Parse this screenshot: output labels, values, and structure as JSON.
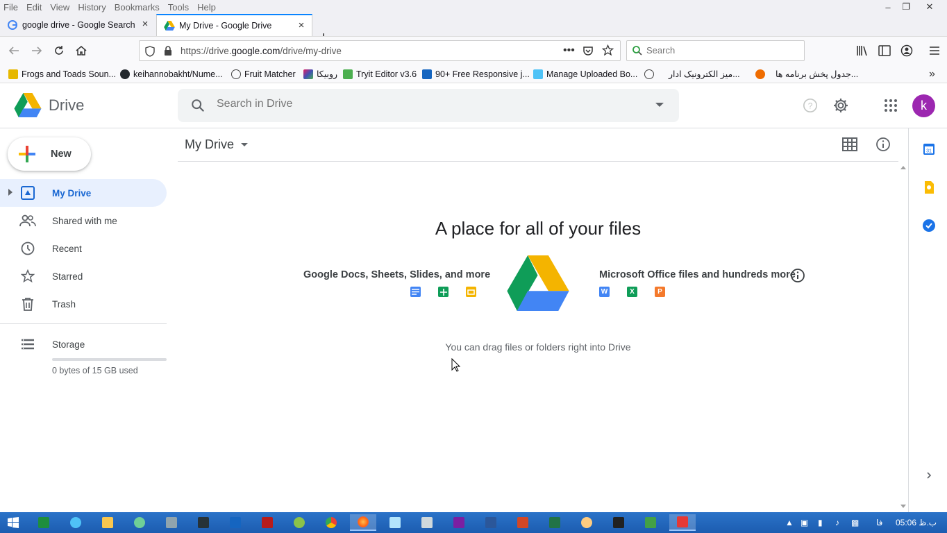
{
  "browser": {
    "menu": [
      "File",
      "Edit",
      "View",
      "History",
      "Bookmarks",
      "Tools",
      "Help"
    ],
    "tabs": [
      {
        "title": "google drive - Google Search",
        "active": false
      },
      {
        "title": "My Drive - Google Drive",
        "active": true
      }
    ],
    "url_prefix": "https://drive.",
    "url_domain": "google.com",
    "url_path": "/drive/my-drive",
    "search_placeholder": "Search",
    "bookmarks": [
      "Frogs and Toads Soun...",
      "keihannobakht/Nume...",
      "Fruit Matcher",
      "روبیکا",
      "Tryit Editor v3.6",
      "90+ Free Responsive j...",
      "Manage Uploaded Bo...",
      "میز الکترونیک ادار...",
      "جدول پخش برنامه ها..."
    ]
  },
  "drive": {
    "logo_text": "Drive",
    "search_placeholder": "Search in Drive",
    "avatar_letter": "k",
    "new_button": "New",
    "sidebar": {
      "items": [
        {
          "label": "My Drive",
          "active": true
        },
        {
          "label": "Shared with me",
          "active": false
        },
        {
          "label": "Recent",
          "active": false
        },
        {
          "label": "Starred",
          "active": false
        },
        {
          "label": "Trash",
          "active": false
        }
      ],
      "storage_label": "Storage",
      "storage_used": "0 bytes of 15 GB used",
      "storage_fraction": 0
    },
    "main": {
      "title": "My Drive",
      "empty_title": "A place for all of your files",
      "left_label": "Google Docs, Sheets, Slides, and more",
      "right_label": "Microsoft Office files and hundreds more",
      "left_icons": [
        "docs-icon",
        "sheets-icon",
        "slides-icon"
      ],
      "right_icons": [
        {
          "name": "word-icon",
          "letter": "W"
        },
        {
          "name": "excel-icon",
          "letter": "X"
        },
        {
          "name": "powerpoint-icon",
          "letter": "P"
        }
      ],
      "drag_hint": "You can drag files or folders right into Drive"
    },
    "colors": {
      "blue": "#4285f4",
      "green": "#0f9d58",
      "yellow": "#f4b400",
      "red": "#db4437",
      "active_nav": "#1967d2"
    }
  },
  "taskbar": {
    "clock": "05:06 ب.ظ",
    "lang": "فا"
  }
}
